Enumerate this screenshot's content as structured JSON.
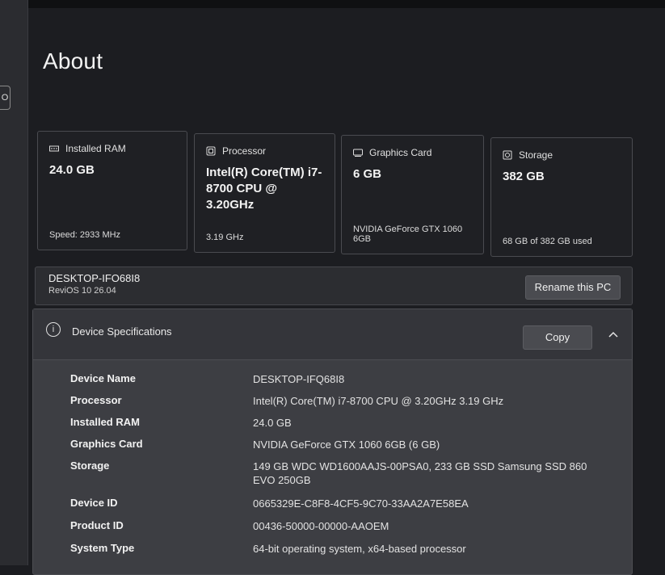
{
  "page": {
    "title": "About"
  },
  "side_button": {
    "glyph": "O"
  },
  "cards": [
    {
      "icon": "ram-icon",
      "label": "Installed RAM",
      "value": "24.0 GB",
      "footer": "Speed: 2933 MHz"
    },
    {
      "icon": "processor-icon",
      "label": "Processor",
      "value": "Intel(R) Core(TM) i7-8700 CPU @ 3.20GHz",
      "footer": "3.19 GHz"
    },
    {
      "icon": "graphics-card-icon",
      "label": "Graphics Card",
      "value": "6 GB",
      "footer": "NVIDIA GeForce GTX 1060 6GB"
    },
    {
      "icon": "storage-icon",
      "label": "Storage",
      "value": "382 GB",
      "footer": "68 GB of 382 GB used"
    }
  ],
  "pc": {
    "name": "DESKTOP-IFO68I8",
    "os": "ReviOS 10 26.04",
    "rename_label": "Rename this PC"
  },
  "specs": {
    "title": "Device Specifications",
    "copy_label": "Copy",
    "rows": [
      {
        "key": "Device Name",
        "value": "DESKTOP-IFQ68I8"
      },
      {
        "key": "Processor",
        "value": "Intel(R) Core(TM) i7-8700 CPU @ 3.20GHz   3.19 GHz"
      },
      {
        "key": "Installed RAM",
        "value": "24.0 GB"
      },
      {
        "key": "Graphics Card",
        "value": "NVIDIA GeForce GTX 1060 6GB (6 GB)"
      },
      {
        "key": "Storage",
        "value": "149 GB WDC WD1600AAJS-00PSA0, 233 GB SSD Samsung SSD 860 EVO 250GB"
      },
      {
        "key": "Device ID",
        "value": "0665329E-C8F8-4CF5-9C70-33AA2A7E58EA"
      },
      {
        "key": "Product ID",
        "value": "00436-50000-00000-AAOEM"
      },
      {
        "key": "System Type",
        "value": "64-bit operating system, x64-based processor"
      }
    ]
  }
}
